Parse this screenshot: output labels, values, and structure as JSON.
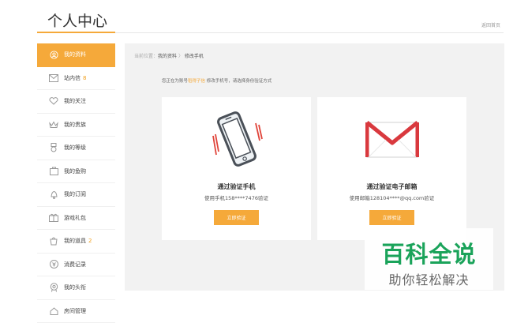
{
  "header": {
    "title": "个人中心",
    "home_link": "返回首页"
  },
  "sidebar": {
    "items": [
      {
        "label": "我的资料",
        "icon": "user-icon"
      },
      {
        "label": "站内信",
        "badge": "8",
        "icon": "mail-icon"
      },
      {
        "label": "我的关注",
        "icon": "heart-icon"
      },
      {
        "label": "我的贵族",
        "icon": "crown-icon"
      },
      {
        "label": "我的等级",
        "icon": "medal-icon"
      },
      {
        "label": "我的鱼购",
        "icon": "bag-icon"
      },
      {
        "label": "我的订阅",
        "icon": "bell-icon"
      },
      {
        "label": "游戏礼包",
        "icon": "gift-icon"
      },
      {
        "label": "我的道具",
        "badge": "2",
        "icon": "box-icon"
      },
      {
        "label": "消费记录",
        "icon": "coin-icon"
      },
      {
        "label": "我的头衔",
        "icon": "badge-icon"
      },
      {
        "label": "房间管理",
        "icon": "room-icon"
      }
    ]
  },
  "breadcrumb": {
    "prefix": "当前位置：",
    "parent": "我的资料",
    "separator": "〉",
    "current": "修改手机"
  },
  "tip": {
    "before": "您正在为账号",
    "account": "稻得子信",
    "after": " 修改手机号，请选择身份验证方式"
  },
  "cards": {
    "phone": {
      "title": "通过验证手机",
      "subtitle": "使用手机158****7476验证",
      "button": "立即验证",
      "icon": "phone-vibrate-icon"
    },
    "email": {
      "title": "通过验证电子邮箱",
      "subtitle": "使用邮箱128104****@qq.com验证",
      "button": "立即验证",
      "icon": "envelope-icon"
    }
  },
  "watermark": {
    "title": "百科全说",
    "subtitle": "助你轻松解决"
  },
  "colors": {
    "accent": "#f5a93a",
    "watermark_green": "#1aa35a",
    "envelope_red": "#d9393e"
  }
}
